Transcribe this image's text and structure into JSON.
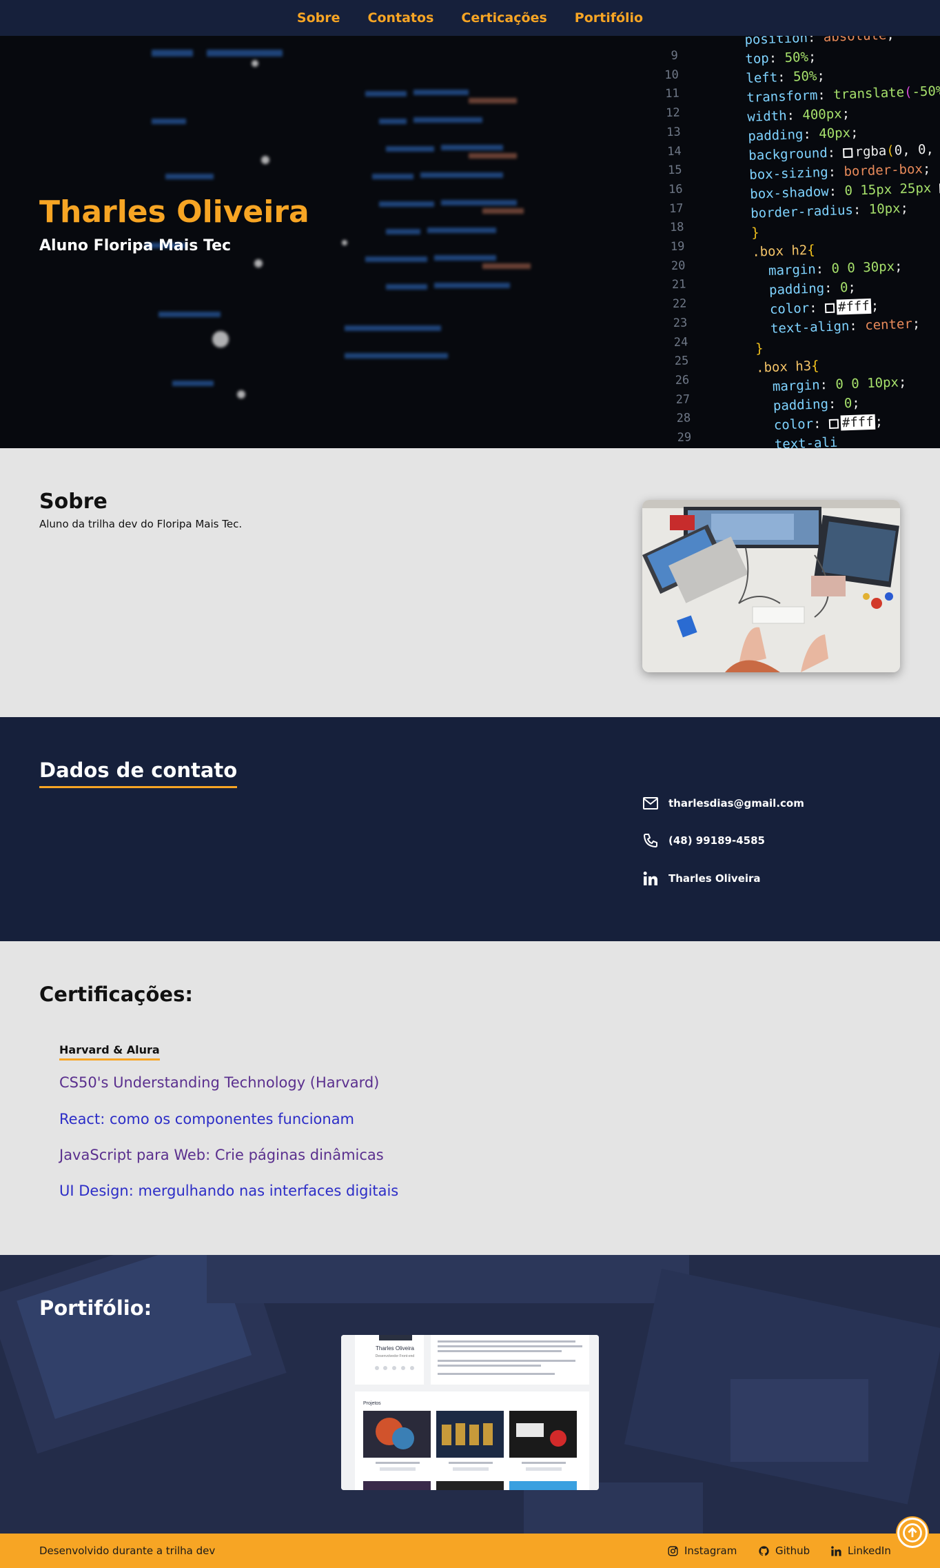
{
  "nav": {
    "items": [
      {
        "label": "Sobre"
      },
      {
        "label": "Contatos"
      },
      {
        "label": "Certicações"
      },
      {
        "label": "Portifólio"
      }
    ]
  },
  "hero": {
    "title": "Tharles Oliveira",
    "subtitle": "Aluno Floripa Mais Tec"
  },
  "about": {
    "heading": "Sobre",
    "text": "Aluno da trilha dev do Floripa Mais Tec."
  },
  "contact": {
    "heading": "Dados de contato",
    "email": "tharlesdias@gmail.com",
    "phone": "(48) 99189-4585",
    "linkedin": "Tharles Oliveira"
  },
  "certifications": {
    "heading": "Certificações:",
    "institution": "Harvard & Alura",
    "items": [
      {
        "label": "CS50's Understanding Technology (Harvard)"
      },
      {
        "label": "React: como os componentes funcionam"
      },
      {
        "label": "JavaScript para Web: Crie páginas dinâmicas"
      },
      {
        "label": "UI Design: mergulhando nas interfaces digitais"
      }
    ]
  },
  "portfolio": {
    "heading": "Portifólio:",
    "preview": {
      "name": "Tharles Oliveira",
      "role": "Desenvolvedor Front-end",
      "section": "Projetos"
    }
  },
  "footer": {
    "text": "Desenvolvido durante a trilha dev",
    "links": [
      {
        "label": "Instagram",
        "icon": "instagram-icon"
      },
      {
        "label": "Github",
        "icon": "github-icon"
      },
      {
        "label": "LinkedIn",
        "icon": "linkedin-icon"
      }
    ]
  },
  "colors": {
    "accent": "#f7a524",
    "navy": "#16203b",
    "background": "#e4e4e4"
  }
}
